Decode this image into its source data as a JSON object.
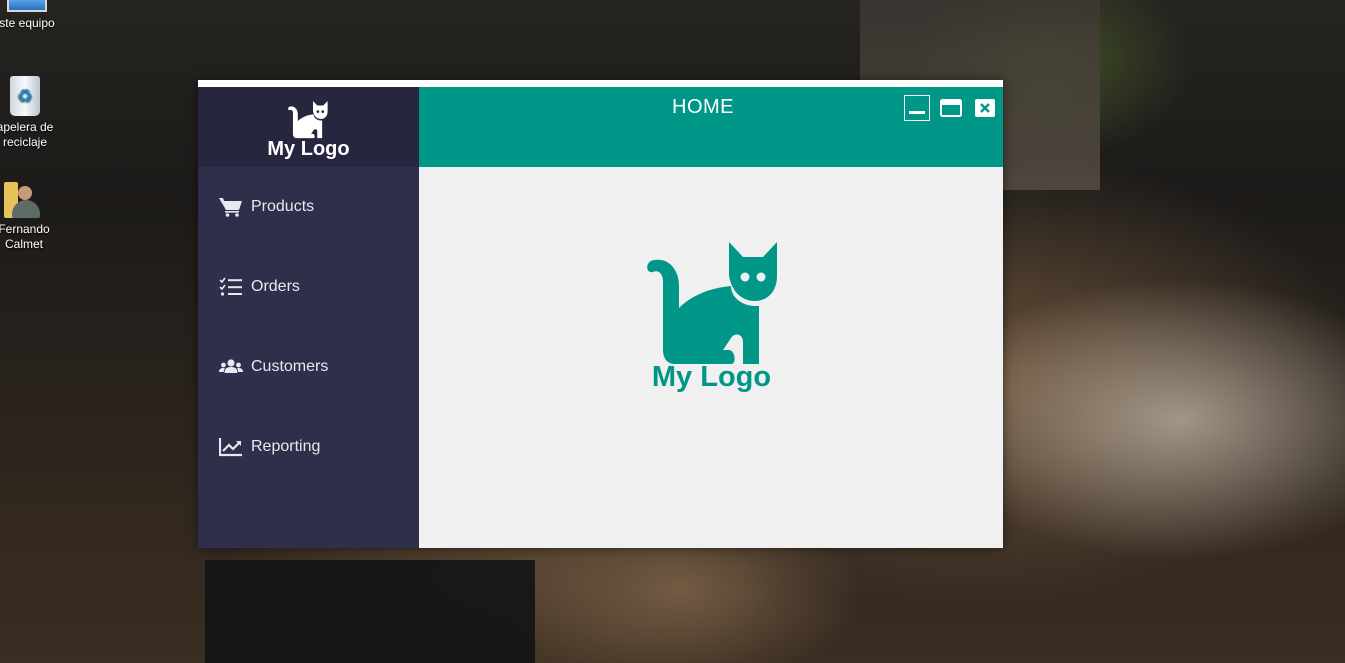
{
  "desktop": {
    "icons": [
      {
        "label": "ste equipo"
      },
      {
        "label": "apelera de\nreciclaje",
        "line1": "apelera de",
        "line2": "reciclaje"
      },
      {
        "label": "Fernando Calmet",
        "line1": "Fernando",
        "line2": "Calmet"
      }
    ]
  },
  "app": {
    "logo_text": "My Logo",
    "title": "HOME",
    "menu": [
      {
        "label": "Products",
        "icon": "cart-icon"
      },
      {
        "label": "Orders",
        "icon": "checklist-icon"
      },
      {
        "label": "Customers",
        "icon": "users-icon"
      },
      {
        "label": "Reporting",
        "icon": "chart-icon"
      }
    ],
    "window_controls": [
      "minimize",
      "maximize",
      "close"
    ],
    "content_logo_text": "My Logo"
  },
  "colors": {
    "accent": "#009688",
    "sidebar": "#2f2e4b",
    "logo_panel": "#27263f",
    "content_bg": "#f0f0f0"
  }
}
